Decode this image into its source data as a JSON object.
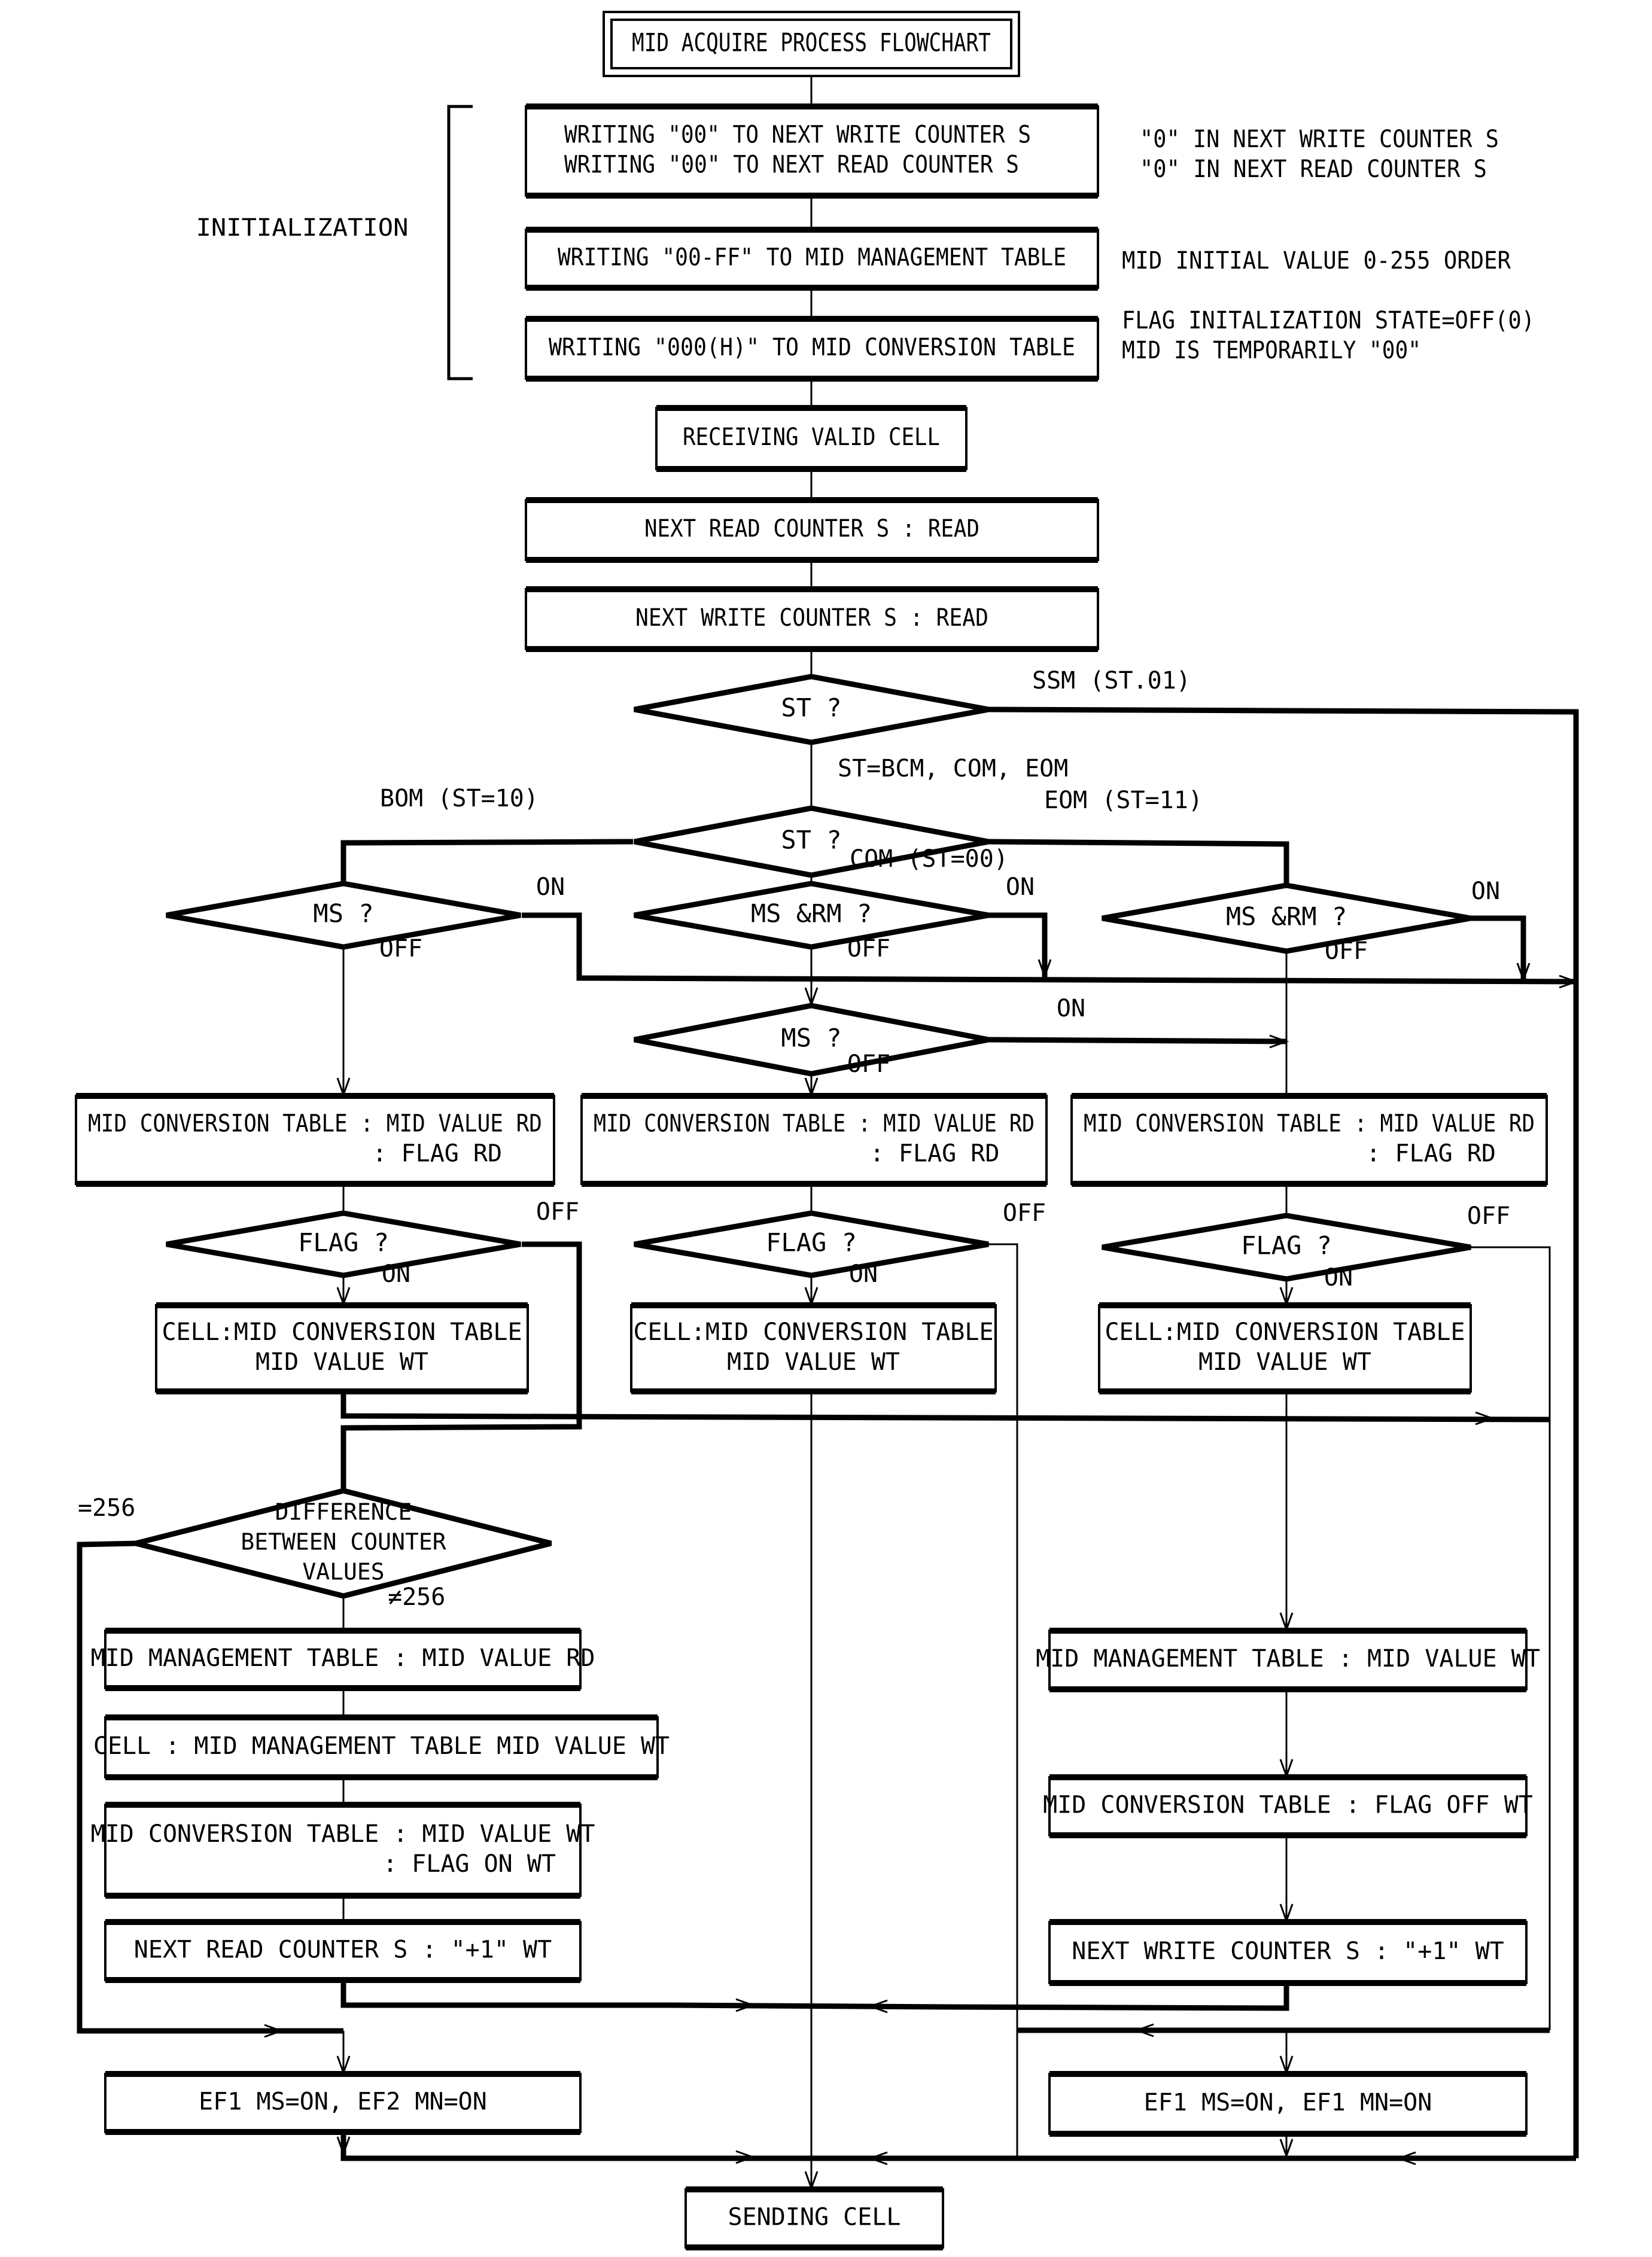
{
  "title": "MID ACQUIRE PROCESS FLOWCHART",
  "initialization": {
    "label": "INITIALIZATION",
    "steps": [
      {
        "lines": [
          "WRITING \"00\" TO NEXT WRITE COUNTER S",
          "WRITING \"00\" TO NEXT READ COUNTER S"
        ],
        "notes": [
          "\"0\" IN NEXT WRITE COUNTER S",
          "\"0\" IN NEXT READ COUNTER S"
        ]
      },
      {
        "lines": [
          "WRITING \"00-FF\" TO MID MANAGEMENT TABLE"
        ],
        "notes": [
          "MID INITIAL VALUE 0-255 ORDER"
        ]
      },
      {
        "lines": [
          "WRITING \"000(H)\" TO MID CONVERSION TABLE"
        ],
        "notes": [
          "FLAG INITALIZATION STATE=OFF(0)",
          "MID IS TEMPORARILY \"00\""
        ]
      }
    ]
  },
  "main_steps": {
    "receiving": "RECEIVING VALID CELL",
    "read_counter": "NEXT READ COUNTER S  : READ",
    "write_counter": "NEXT WRITE COUNTER S  : READ"
  },
  "decisions": {
    "st1": "ST ?",
    "st2": "ST ?",
    "ms_left": "MS ?",
    "msrm_mid": "MS &RM ?",
    "msrm_right": "MS &RM ?",
    "ms_mid": "MS ?",
    "flag": "FLAG ?",
    "difference": [
      "DIFFERENCE",
      "BETWEEN COUNTER",
      "VALUES"
    ]
  },
  "branch_labels": {
    "ssm": "SSM (ST.01)",
    "st_bcm": "ST=BCM, COM, EOM",
    "bom": "BOM (ST=10)",
    "eom": "EOM (ST=11)",
    "com": "COM (ST=00)",
    "on": "ON",
    "off": "OFF",
    "eq256": "=256",
    "ne256": "≠256"
  },
  "conversion_read": [
    "MID CONVERSION TABLE : MID VALUE RD",
    ": FLAG RD"
  ],
  "cell_write": [
    "CELL:MID CONVERSION TABLE",
    "MID VALUE WT"
  ],
  "left_column": [
    [
      "MID MANAGEMENT TABLE : MID VALUE RD"
    ],
    [
      "CELL  :  MID MANAGEMENT TABLE MID VALUE WT"
    ],
    [
      "MID CONVERSION TABLE : MID VALUE WT",
      ": FLAG ON WT"
    ],
    [
      "NEXT READ COUNTER S  :  \"+1\" WT"
    ],
    [
      "EF1 MS=ON,  EF2 MN=ON"
    ]
  ],
  "right_column": [
    [
      "MID MANAGEMENT TABLE : MID VALUE WT"
    ],
    [
      "MID CONVERSION TABLE : FLAG OFF WT"
    ],
    [
      "NEXT WRITE COUNTER S  :  \"+1\" WT"
    ],
    [
      "EF1 MS=ON,  EF1 MN=ON"
    ]
  ],
  "end": "SENDING CELL"
}
